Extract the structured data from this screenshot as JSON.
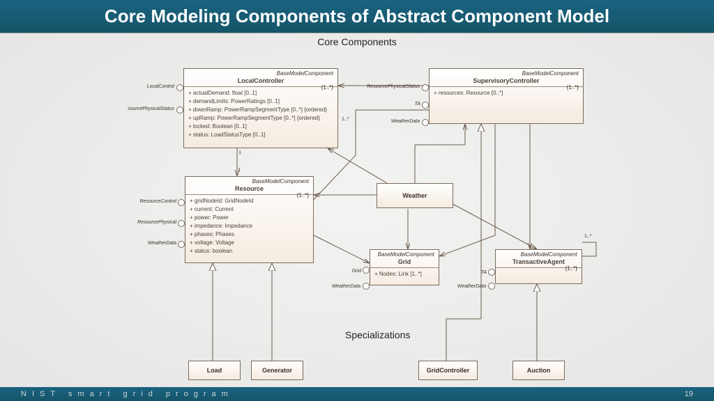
{
  "title": "Core Modeling Components of Abstract Component Model",
  "subtitle": "Core Components",
  "specializations_label": "Specializations",
  "footer_text": "NIST smart grid program",
  "page_number": "19",
  "stereotype": "BaseModelComponent",
  "classes": {
    "LocalController": {
      "name": "LocalController",
      "mult": "{1..*}",
      "attrs": [
        "+  actualDemand: float [0..1]",
        "+  demandLimits: PowerRatings [0..1]",
        "+  downRamp: PowerRampSegmentType [0..*] {ordered}",
        "+  upRamp: PowerRampSegmentType [0..*] {ordered}",
        "+  locked: Boolean [0..1]",
        "+  status: LoadStatusType [0..1]"
      ],
      "ports": [
        "LocalControl",
        "sourcePhysicalStatus"
      ],
      "assoc_mult_bottom": "1",
      "assoc_mult_right": "1..*"
    },
    "SupervisoryController": {
      "name": "SupervisoryController",
      "mult": "{1..*}",
      "attrs": [
        "+  resources: Resource [0..*]"
      ],
      "ports": [
        "ResourcePhysicalStatus",
        "TA",
        "WeatherData"
      ]
    },
    "Resource": {
      "name": "Resource",
      "mult": "{1..*}",
      "attrs": [
        "+  gridNodeId: GridNodeId",
        "+  current: Current",
        "+  power: Power",
        "+  impedance: Impedance",
        "+  phases: Phases",
        "+  voltage: Voltage",
        "+  status: boolean"
      ],
      "ports": [
        "ResourceControl",
        "ResourcePhysical",
        "WeatherData"
      ],
      "assoc_mult_top": "1"
    },
    "Weather": {
      "name": "Weather"
    },
    "Grid": {
      "name": "Grid",
      "attrs": [
        "+  Nodes: Link [1..*]"
      ],
      "ports": [
        "Grid",
        "WeatherData"
      ]
    },
    "TransactiveAgent": {
      "name": "TransactiveAgent",
      "mult": "{1..*}",
      "ports": [
        "TA",
        "WeatherData"
      ],
      "self_mult": "1..*"
    },
    "Load": {
      "name": "Load"
    },
    "Generator": {
      "name": "Generator"
    },
    "GridController": {
      "name": "GridController"
    },
    "Auction": {
      "name": "Auction"
    }
  }
}
